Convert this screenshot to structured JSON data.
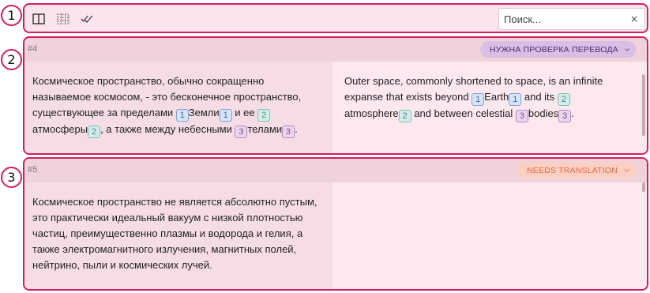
{
  "callouts": [
    "1",
    "2",
    "3"
  ],
  "toolbar": {
    "icons": [
      "split-view-icon",
      "grid-icon",
      "checklist-icon"
    ],
    "search": {
      "placeholder": "Поиск...",
      "value": "",
      "clear_icon": "×"
    }
  },
  "segments": [
    {
      "id": "#4",
      "status": "НУЖНА ПРОВЕРКА ПЕРЕВОДА",
      "source": [
        {
          "t": "Космическое пространство, обычно сокращенно называемое космосом, - это бесконечное пространство, существующее за пределами "
        },
        {
          "tag": "1",
          "k": 1
        },
        {
          "t": "Земли"
        },
        {
          "tag": "1",
          "k": 1
        },
        {
          "t": " и ее "
        },
        {
          "tag": "2",
          "k": 2
        },
        {
          "t": "атмосферы"
        },
        {
          "tag": "2",
          "k": 2
        },
        {
          "t": ", а также между небесными "
        },
        {
          "tag": "3",
          "k": 3
        },
        {
          "t": "телами"
        },
        {
          "tag": "3",
          "k": 3
        },
        {
          "t": "."
        }
      ],
      "target": [
        {
          "t": "Outer space, commonly shortened to space, is an infinite expanse that exists beyond "
        },
        {
          "tag": "1",
          "k": 1
        },
        {
          "t": "Earth"
        },
        {
          "tag": "1",
          "k": 1
        },
        {
          "t": " and its "
        },
        {
          "tag": "2",
          "k": 2
        },
        {
          "t": "atmosphere"
        },
        {
          "tag": "2",
          "k": 2
        },
        {
          "t": " and between celestial "
        },
        {
          "tag": "3",
          "k": 3
        },
        {
          "t": "bodies"
        },
        {
          "tag": "3",
          "k": 3
        },
        {
          "t": "."
        }
      ]
    },
    {
      "id": "#5",
      "status": "NEEDS TRANSLATION",
      "source": [
        {
          "t": "Космическое пространство не является абсолютно пустым, это практически идеальный вакуум с низкой плотностью частиц, преимущественно плазмы и водорода и гелия, а также электромагнитного излучения, магнитных полей, нейтрино, пыли и космических лучей."
        }
      ],
      "target": []
    }
  ],
  "colors": {
    "highlight_border": "#d21f5b",
    "status_review_bg": "#d9bfe6",
    "status_new_bg": "#fbd0c3"
  }
}
